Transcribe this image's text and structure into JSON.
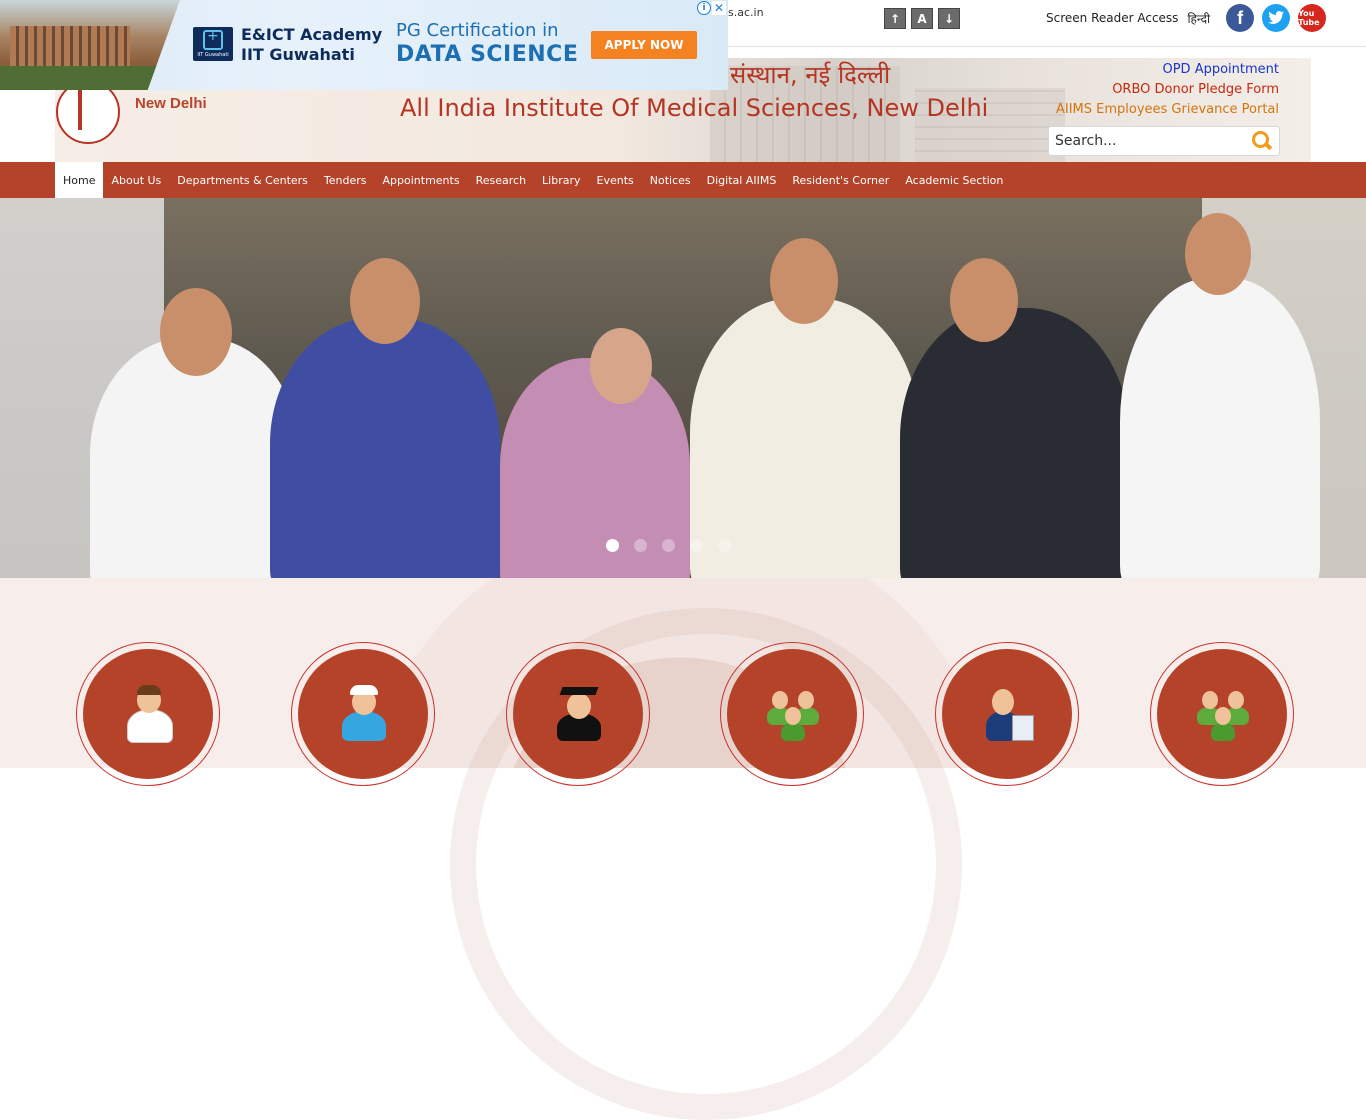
{
  "topbar": {
    "site_url": "s.ac.in",
    "font_controls": [
      "↑",
      "A",
      "↓"
    ],
    "screen_reader_label": "Screen Reader Access",
    "language_label": "हिन्दी",
    "social": {
      "facebook": "f",
      "youtube": "You Tube"
    }
  },
  "ad": {
    "org_line1": "E&ICT Academy",
    "org_line2": "IIT Guwahati",
    "logo_caption": "IIT Guwahati",
    "cert_line": "PG Certification in",
    "ds_line": "DATA SCIENCE",
    "cta": "APPLY NOW",
    "info_icon": "i",
    "close_icon": "✕"
  },
  "header": {
    "logo_text": "New Delhi",
    "title_hindi": "संस्थान, नई दिल्ली",
    "title_english": "All India Institute Of Medical Sciences, New Delhi",
    "quick_links": [
      "OPD Appointment",
      "ORBO Donor Pledge Form",
      "AIIMS Employees Grievance Portal"
    ],
    "search_placeholder": "Search..."
  },
  "nav": {
    "items": [
      "Home",
      "About Us",
      "Departments & Centers",
      "Tenders",
      "Appointments",
      "Research",
      "Library",
      "Events",
      "Notices",
      "Digital AIIMS",
      "Resident's Corner",
      "Academic Section"
    ],
    "active_index": 0
  },
  "slider": {
    "slide_count": 5,
    "active_slide": 1
  },
  "colors": {
    "brand": "#b5432a",
    "title_red": "#b43522",
    "link_blue": "#1a35c9",
    "apply_orange": "#f58220"
  },
  "quick_tiles": [
    "doctor-icon",
    "nurse-icon",
    "graduate-icon",
    "group-icon",
    "presenter-icon",
    "group-icon"
  ]
}
